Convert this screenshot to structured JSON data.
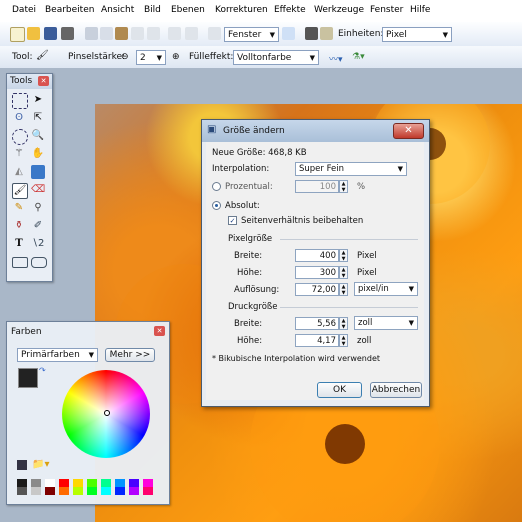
{
  "menu": [
    "Datei",
    "Bearbeiten",
    "Ansicht",
    "Bild",
    "Ebenen",
    "Korrekturen",
    "Effekte",
    "Werkzeuge",
    "Fenster",
    "Hilfe"
  ],
  "toolbar1": {
    "window_select": "Fenster",
    "units_label": "Einheiten:",
    "units_value": "Pixel"
  },
  "toolbar2": {
    "tool_label": "Tool:",
    "brush_label": "Pinselstärke:",
    "brush_value": "2",
    "fill_label": "Fülleffekt:",
    "fill_value": "Volltonfarbe"
  },
  "tools_panel": {
    "title": "Tools"
  },
  "colors_panel": {
    "title": "Farben",
    "mode_select": "Primärfarben",
    "more_button": "Mehr >>",
    "palette": [
      "#1a1a1a",
      "#555555",
      "#8a8a8a",
      "#c8c8c8",
      "#ffffff",
      "#7f0000",
      "#ff0000",
      "#ff6a00",
      "#ffd800",
      "#b6ff00",
      "#4cff00",
      "#00ff21",
      "#00ff90",
      "#00ffff",
      "#0094ff",
      "#0026ff",
      "#4800ff",
      "#b200ff",
      "#ff00dc",
      "#ff006e"
    ]
  },
  "dialog": {
    "title": "Größe ändern",
    "new_size": "Neue Größe: 468,8 KB",
    "interpolation_label": "Interpolation:",
    "interpolation_value": "Super Fein",
    "percent_label": "Prozentual:",
    "percent_value": "100",
    "percent_unit": "%",
    "absolute_label": "Absolut:",
    "keep_ratio_label": "Seitenverhältnis beibehalten",
    "pixel_size_heading": "Pixelgröße",
    "width_label": "Breite:",
    "width_value": "400",
    "width_unit": "Pixel",
    "height_label": "Höhe:",
    "height_value": "300",
    "height_unit": "Pixel",
    "resolution_label": "Auflösung:",
    "resolution_value": "72,00",
    "resolution_unit": "pixel/in",
    "print_size_heading": "Druckgröße",
    "print_width_label": "Breite:",
    "print_width_value": "5,56",
    "print_width_unit": "zoll",
    "print_height_label": "Höhe:",
    "print_height_value": "4,17",
    "print_height_unit": "zoll",
    "footnote": "* Bikubische Interpolation wird verwendet",
    "ok_button": "OK",
    "cancel_button": "Abbrechen"
  }
}
